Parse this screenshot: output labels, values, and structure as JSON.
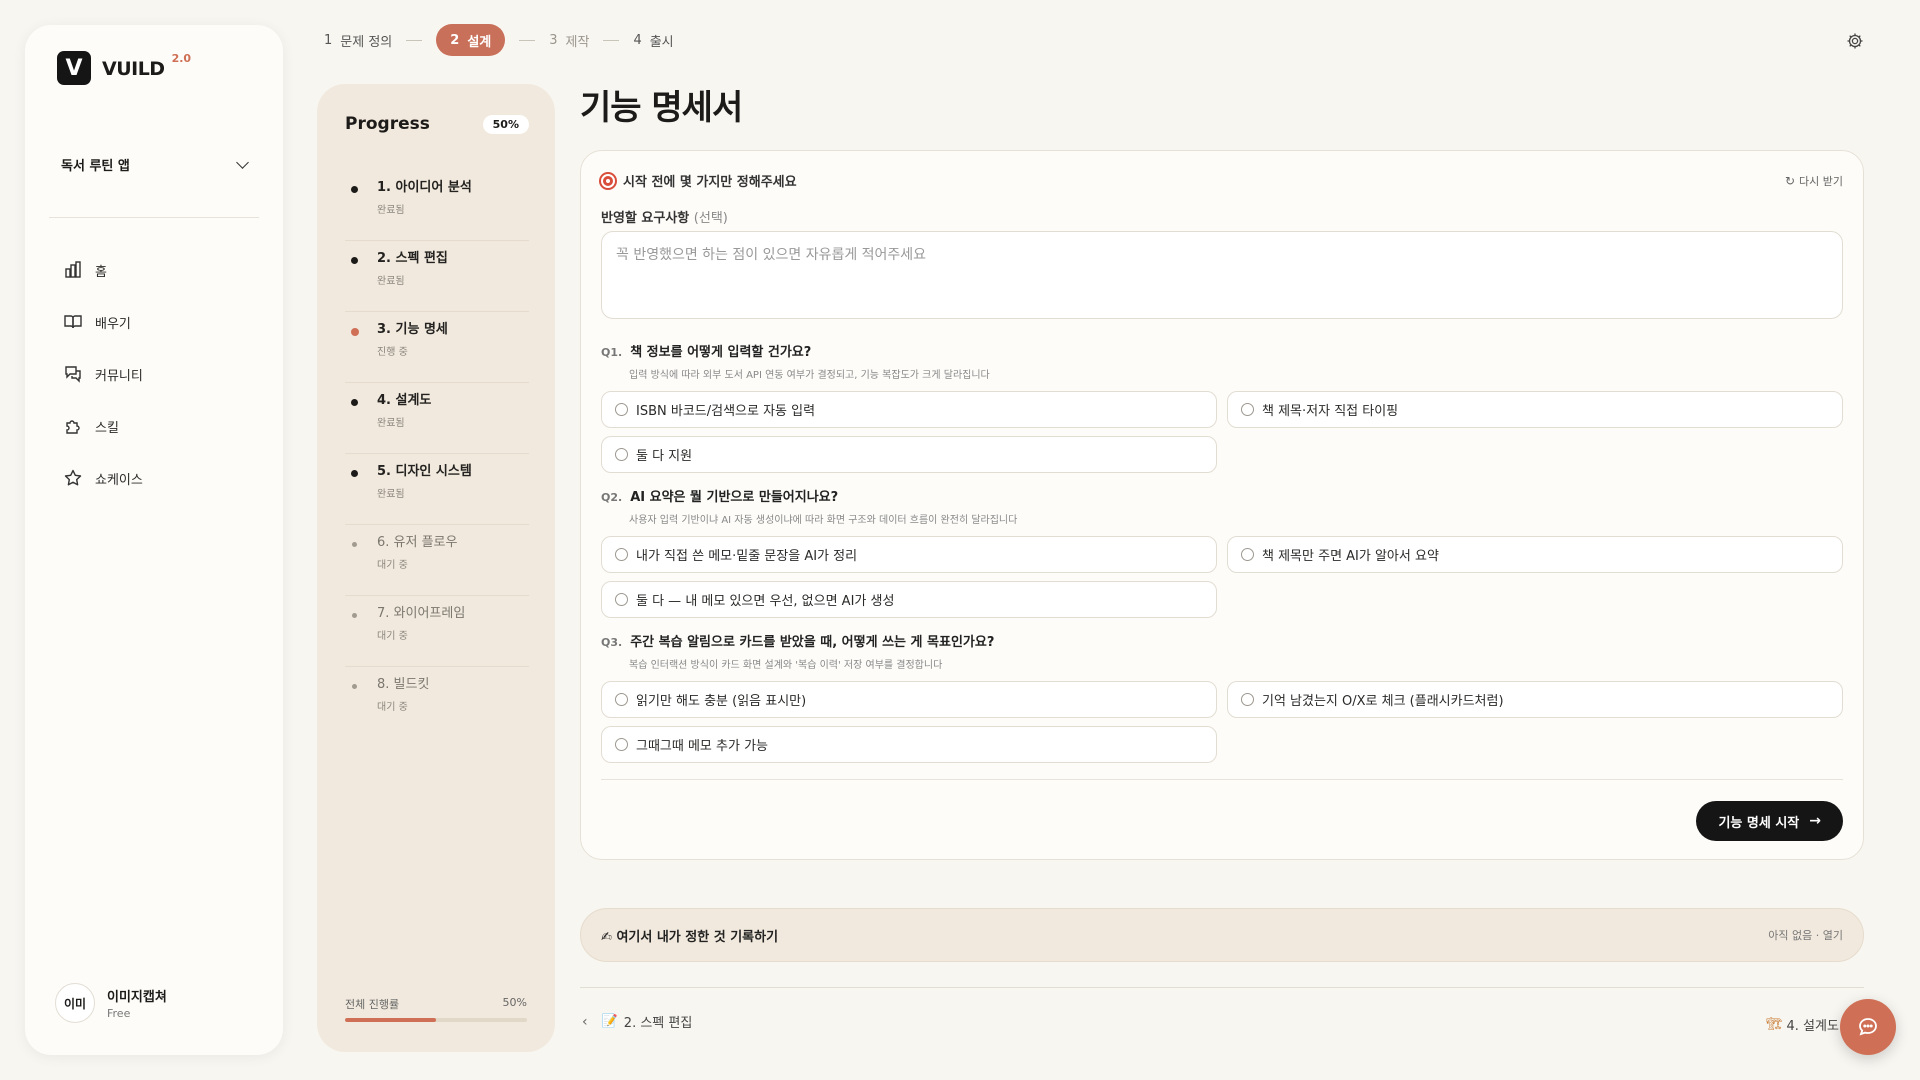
{
  "app": {
    "name": "VUILD",
    "version": "2.0",
    "logo_letter": "V"
  },
  "sidebar": {
    "project": "독서 루틴 앱",
    "nav": [
      {
        "label": "홈",
        "icon": "chart-icon"
      },
      {
        "label": "배우기",
        "icon": "book-icon"
      },
      {
        "label": "커뮤니티",
        "icon": "chat-icon"
      },
      {
        "label": "스킬",
        "icon": "puzzle-icon"
      },
      {
        "label": "쇼케이스",
        "icon": "star-icon"
      }
    ],
    "user": {
      "avatar": "이미",
      "name": "이미지캡쳐",
      "plan": "Free"
    }
  },
  "stepper": [
    {
      "num": "1",
      "label": "문제 정의",
      "state": "done"
    },
    {
      "num": "2",
      "label": "설계",
      "state": "active"
    },
    {
      "num": "3",
      "label": "제작",
      "state": "pending"
    },
    {
      "num": "4",
      "label": "출시",
      "state": "done"
    }
  ],
  "progress": {
    "title": "Progress",
    "badge": "50%",
    "items": [
      {
        "name": "1. 아이디어 분석",
        "status": "완료됨",
        "state": "done"
      },
      {
        "name": "2. 스펙 편집",
        "status": "완료됨",
        "state": "done"
      },
      {
        "name": "3. 기능 명세",
        "status": "진행 중",
        "state": "current"
      },
      {
        "name": "4. 설계도",
        "status": "완료됨",
        "state": "done"
      },
      {
        "name": "5. 디자인 시스템",
        "status": "완료됨",
        "state": "done"
      },
      {
        "name": "6. 유저 플로우",
        "status": "대기 중",
        "state": "pending"
      },
      {
        "name": "7. 와이어프레임",
        "status": "대기 중",
        "state": "pending"
      },
      {
        "name": "8. 빌드킷",
        "status": "대기 중",
        "state": "pending"
      }
    ],
    "total_label": "전체 진행률",
    "total_value": "50%",
    "total_fraction": 0.5
  },
  "main": {
    "title": "기능 명세서",
    "card": {
      "head_title": "시작 전에 몇 가지만 정해주세요",
      "refresh_label": "다시 받기",
      "req_label": "반영할 요구사항",
      "req_optional": "(선택)",
      "req_placeholder": "꼭 반영했으면 하는 점이 있으면 자유롭게 적어주세요",
      "questions": [
        {
          "num": "Q1.",
          "title": "책 정보를 어떻게 입력할 건가요?",
          "desc": "입력 방식에 따라 외부 도서 API 연동 여부가 결정되고, 기능 복잡도가 크게 달라집니다",
          "options": [
            "ISBN 바코드/검색으로 자동 입력",
            "책 제목·저자 직접 타이핑",
            "둘 다 지원"
          ]
        },
        {
          "num": "Q2.",
          "title": "AI 요약은 뭘 기반으로 만들어지나요?",
          "desc": "사용자 입력 기반이냐 AI 자동 생성이냐에 따라 화면 구조와 데이터 흐름이 완전히 달라집니다",
          "options": [
            "내가 직접 쓴 메모·밑줄 문장을 AI가 정리",
            "책 제목만 주면 AI가 알아서 요약",
            "둘 다 — 내 메모 있으면 우선, 없으면 AI가 생성"
          ]
        },
        {
          "num": "Q3.",
          "title": "주간 복습 알림으로 카드를 받았을 때, 어떻게 쓰는 게 목표인가요?",
          "desc": "복습 인터랙션 방식이 카드 화면 설계와 '복습 이력' 저장 여부를 결정합니다",
          "options": [
            "읽기만 해도 충분 (읽음 표시만)",
            "기억 남겼는지 O/X로 체크 (플래시카드처럼)",
            "그때그때 메모 추가 가능"
          ]
        }
      ],
      "start_label": "기능 명세 시작"
    },
    "record": {
      "title": "여기서 내가 정한 것 기록하기",
      "meta": "아직 없음 · 열기"
    },
    "prev": {
      "emoji": "📝",
      "label": "2. 스펙 편집"
    },
    "next": {
      "emoji": "🏗",
      "label": "4. 설계도"
    }
  },
  "colors": {
    "accent": "#cf6f55",
    "dark": "#151515",
    "panel": "#f1e9dd",
    "background": "#f8f6f1"
  }
}
